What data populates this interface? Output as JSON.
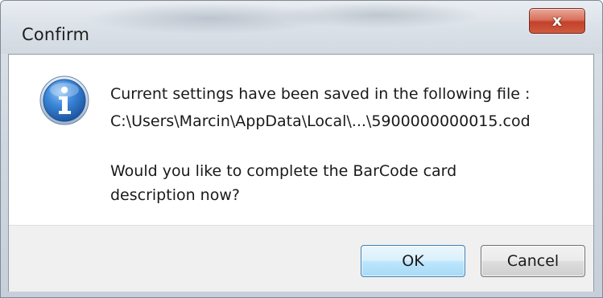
{
  "window": {
    "title": "Confirm",
    "close_glyph": "x"
  },
  "icon": {
    "name": "information-icon",
    "glyph": "i",
    "color": "#2a6fc9"
  },
  "message": {
    "line1": "Current settings have been saved in the following file :",
    "line2": "C:\\Users\\Marcin\\AppData\\Local\\...\\5900000000015.cod",
    "line3": "Would you like to complete the BarCode card",
    "line4": "description now?"
  },
  "buttons": {
    "ok_label": "OK",
    "cancel_label": "Cancel"
  }
}
